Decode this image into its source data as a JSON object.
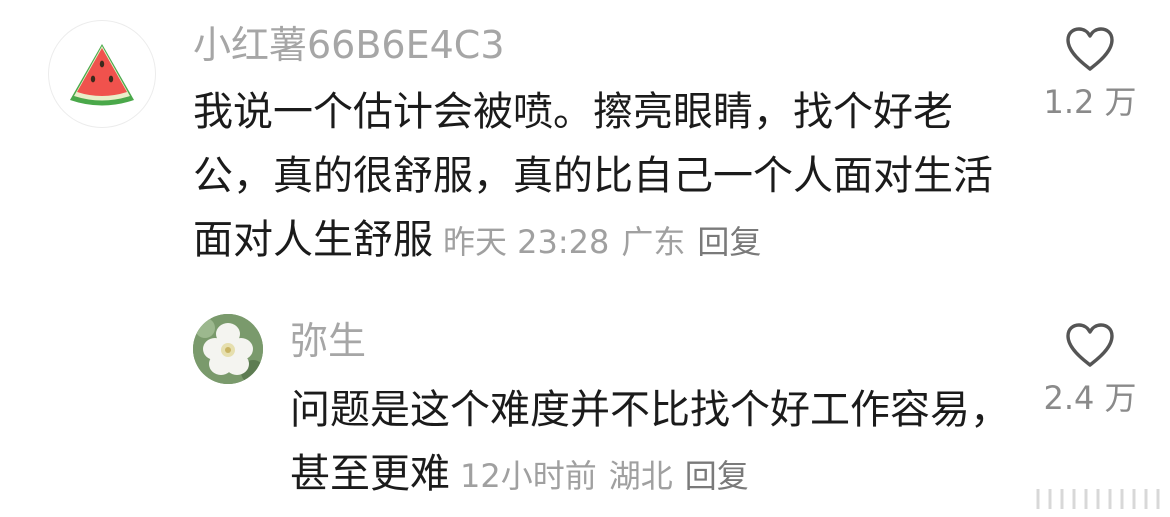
{
  "comments": [
    {
      "username": "小红薯66B6E4C3",
      "avatar": "watermelon-slice-icon",
      "text": "我说一个估计会被喷。擦亮眼睛，找个好老公，真的很舒服，真的比自己一个人面对生活面对人生舒服",
      "time": "昨天 23:28",
      "location": "广东",
      "reply_label": "回复",
      "likes": "1.2 万",
      "reply": {
        "username": "弥生",
        "avatar": "white-flower-photo",
        "text": "问题是这个难度并不比找个好工作容易，甚至更难",
        "time": "12小时前",
        "location": "湖北",
        "reply_label": "回复",
        "likes": "2.4 万"
      }
    }
  ],
  "colors": {
    "username": "#a6a6a6",
    "body_text": "#1b1b1b",
    "meta": "#a0a0a0",
    "icon_stroke": "#555555"
  }
}
